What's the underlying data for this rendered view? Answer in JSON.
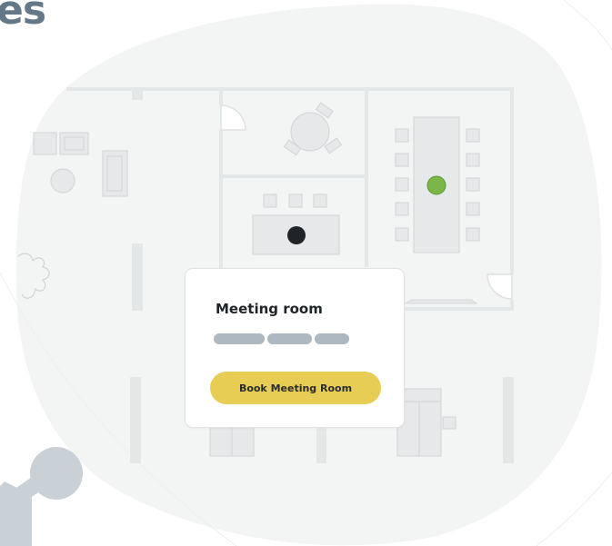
{
  "heading_fragment": "es",
  "booking_card": {
    "title": "Meeting room",
    "book_button_label": "Book Meeting Room"
  },
  "colors": {
    "background_blob": "#f3f5f5",
    "wall": "#e4e7e8",
    "furniture": "#e6e8e9",
    "selected_seat": "#7ab648",
    "occupied_seat": "#212427",
    "heading": "#647987",
    "accent_button": "#e8cd55",
    "skeleton_pill": "#aeb8c0",
    "avatar_decoration": "#c9d1d6"
  },
  "icons": [
    "plant-icon",
    "avatar-decoration-icon"
  ]
}
